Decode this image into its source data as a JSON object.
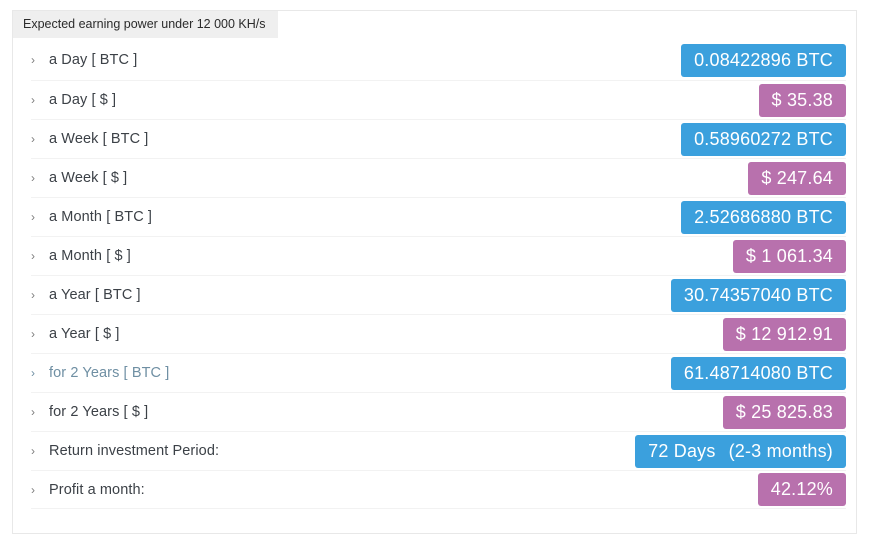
{
  "panel": {
    "header_tab_label": "Expected earning power under 12 000 KH/s",
    "chevron_icon": "chevron-right-icon"
  },
  "colors": {
    "btc_badge": "#3ba0dd",
    "usd_badge": "#b871ad",
    "header_tab_bg": "#efefef",
    "label_text": "#3c4147",
    "label_text_hover": "#6f8fa3",
    "row_divider": "#f2f2f2",
    "panel_border": "#e8e8e8"
  },
  "rows": [
    {
      "label": "a Day [ BTC ]",
      "value": "0.08422896 BTC",
      "value2": "",
      "type": "btc",
      "hovered": false
    },
    {
      "label": "a Day [ $ ]",
      "value": "$ 35.38",
      "value2": "",
      "type": "usd",
      "hovered": false
    },
    {
      "label": "a Week [ BTC ]",
      "value": "0.58960272 BTC",
      "value2": "",
      "type": "btc",
      "hovered": false
    },
    {
      "label": "a Week [ $ ]",
      "value": "$ 247.64",
      "value2": "",
      "type": "usd",
      "hovered": false
    },
    {
      "label": "a Month [ BTC ]",
      "value": "2.52686880 BTC",
      "value2": "",
      "type": "btc",
      "hovered": false
    },
    {
      "label": "a Month [ $ ]",
      "value": "$ 1 061.34",
      "value2": "",
      "type": "usd",
      "hovered": false
    },
    {
      "label": "a Year [ BTC ]",
      "value": "30.74357040 BTC",
      "value2": "",
      "type": "btc",
      "hovered": false
    },
    {
      "label": "a Year [ $ ]",
      "value": "$ 12 912.91",
      "value2": "",
      "type": "usd",
      "hovered": false
    },
    {
      "label": "for 2 Years [ BTC ]",
      "value": "61.48714080 BTC",
      "value2": "",
      "type": "btc",
      "hovered": true
    },
    {
      "label": "for 2 Years [ $ ]",
      "value": "$ 25 825.83",
      "value2": "",
      "type": "usd",
      "hovered": false
    },
    {
      "label": "Return investment Period:",
      "value": "72 Days",
      "value2": "(2-3 months)",
      "type": "btc",
      "hovered": false
    },
    {
      "label": "Profit a month:",
      "value": "42.12%",
      "value2": "",
      "type": "usd",
      "hovered": false
    }
  ]
}
